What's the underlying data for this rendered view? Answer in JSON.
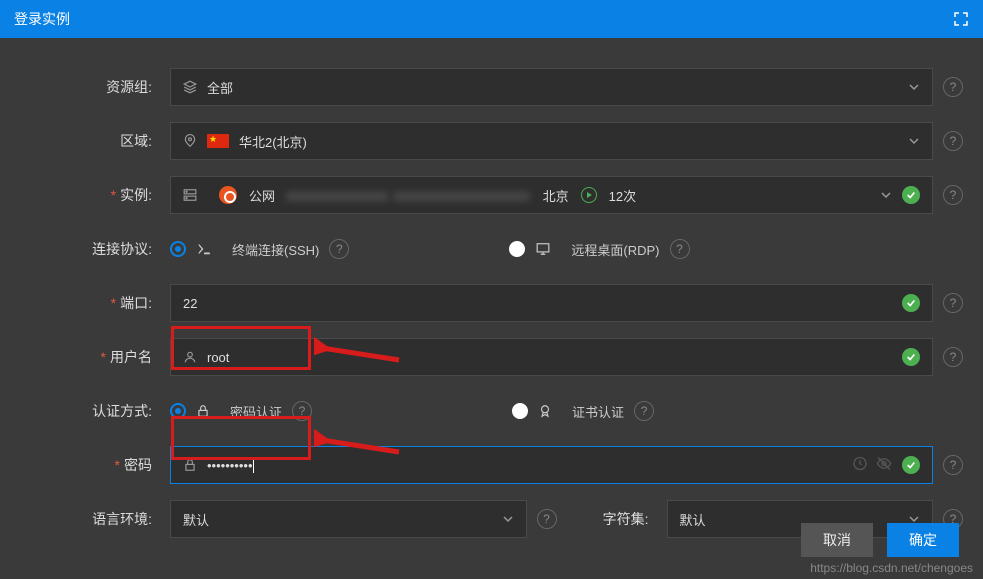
{
  "title": "登录实例",
  "labels": {
    "resourceGroup": "资源组:",
    "region": "区域:",
    "instance": "实例:",
    "protocol": "连接协议:",
    "port": "端口:",
    "username": "用户名",
    "authMethod": "认证方式:",
    "password": "密码",
    "locale": "语言环境:",
    "charset": "字符集:"
  },
  "values": {
    "resourceGroup": "全部",
    "region": "华北2(北京)",
    "instanceNetwork": "公网",
    "instanceRegion": "北京",
    "instanceCount": "12次",
    "port": "22",
    "username": "root",
    "password": "••••••••••",
    "locale": "默认",
    "charset": "默认"
  },
  "options": {
    "protocolSSH": "终端连接(SSH)",
    "protocolRDP": "远程桌面(RDP)",
    "authPassword": "密码认证",
    "authCert": "证书认证"
  },
  "buttons": {
    "cancel": "取消",
    "confirm": "确定"
  },
  "watermark": "https://blog.csdn.net/chengoes"
}
